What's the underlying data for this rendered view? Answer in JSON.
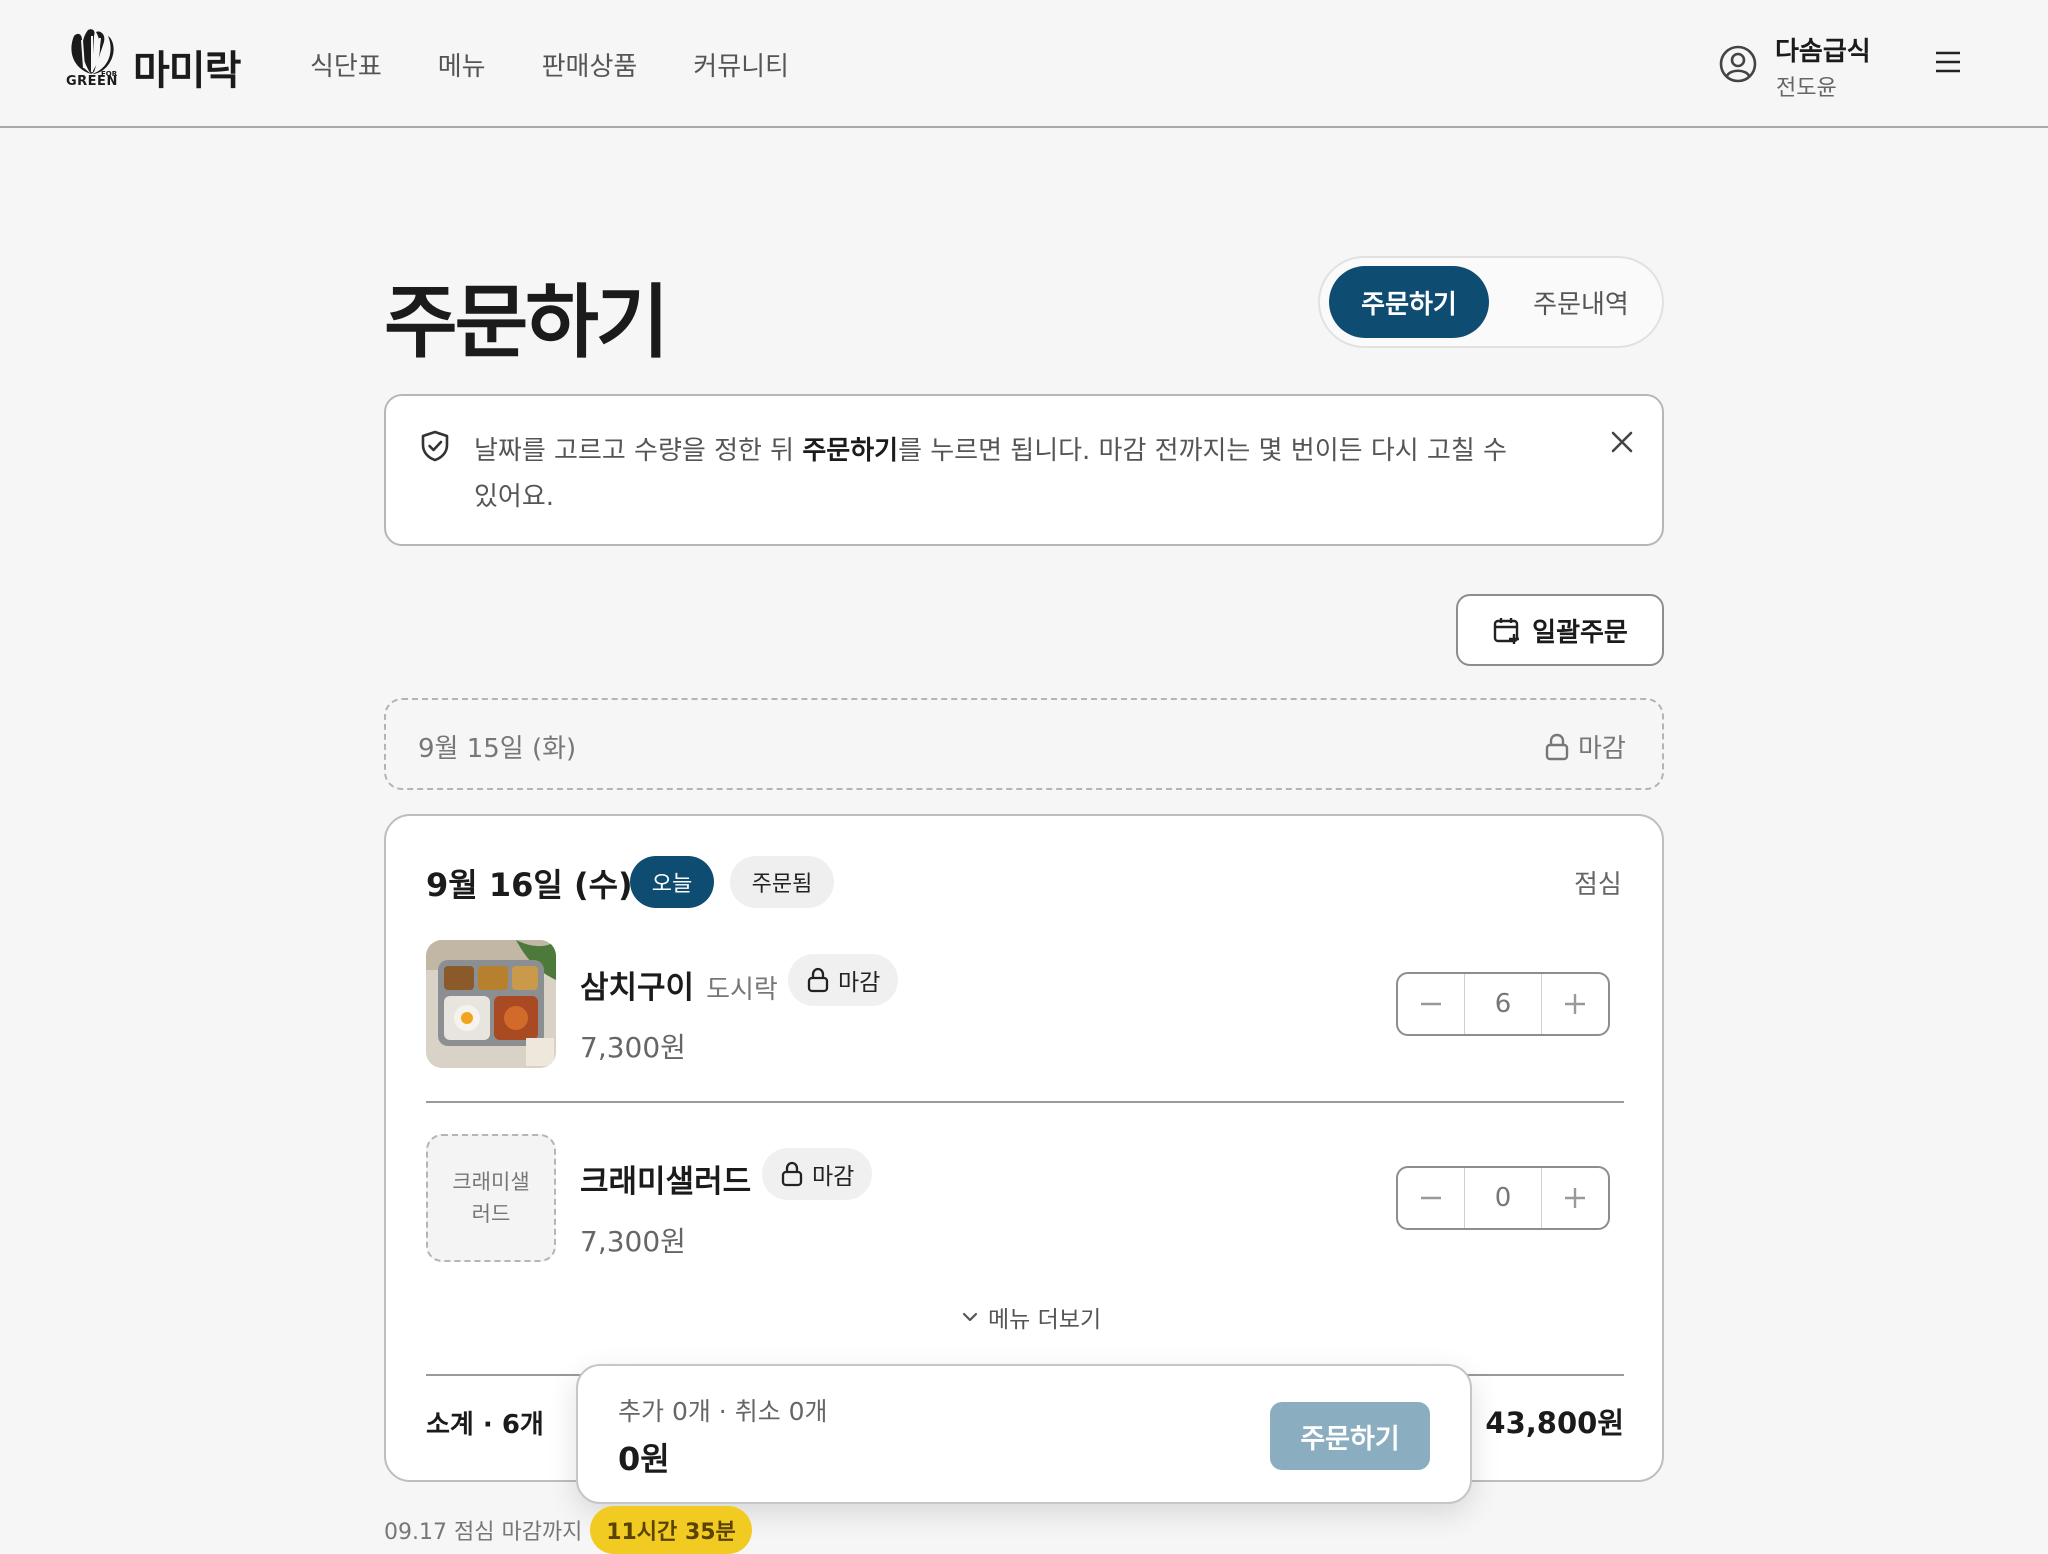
{
  "header": {
    "logo_text": "마미락",
    "logo_green": "GREEN",
    "logo_for": "FOR",
    "nav": [
      "식단표",
      "메뉴",
      "판매상품",
      "커뮤니티"
    ],
    "user_name": "다솜급식",
    "user_sub": "전도윤"
  },
  "page": {
    "title": "주문하기",
    "tabs": {
      "active": "주문하기",
      "other": "주문내역"
    }
  },
  "notice": {
    "pre": "날짜를 고르고 수량을 정한 뒤 ",
    "bold": "주문하기",
    "post": "를 누르면 됩니다. 마감 전까지는 몇 번이든 다시 고칠 수 있어요."
  },
  "bulk_order_label": "일괄주문",
  "closed_day": {
    "date": "9월 15일 (화)",
    "status": "마감"
  },
  "day_card": {
    "date": "9월 16일 (수)",
    "badge_today": "오늘",
    "badge_ordered": "주문됨",
    "meal_type": "점심",
    "items": [
      {
        "name": "삼치구이",
        "sub": "도시락",
        "lock": "마감",
        "price": "7,300원",
        "qty": "6"
      },
      {
        "name": "크래미샐러드",
        "sub": "",
        "lock": "마감",
        "price": "7,300원",
        "qty": "0",
        "thumb_text": "크래미샐러드"
      }
    ],
    "more_label": "메뉴 더보기",
    "subtotal_label": "소계 · 6개",
    "subtotal_value": "43,800원"
  },
  "float_bar": {
    "summary": "추가 0개 · 취소 0개",
    "total": "0원",
    "button": "주문하기"
  },
  "deadline": {
    "text": "09.17 점심 마감까지",
    "badge": "11시간 35분"
  },
  "colors": {
    "primary": "#0f4c72",
    "button_disabled": "#8aaec0",
    "deadline_badge": "#f2cb22"
  }
}
